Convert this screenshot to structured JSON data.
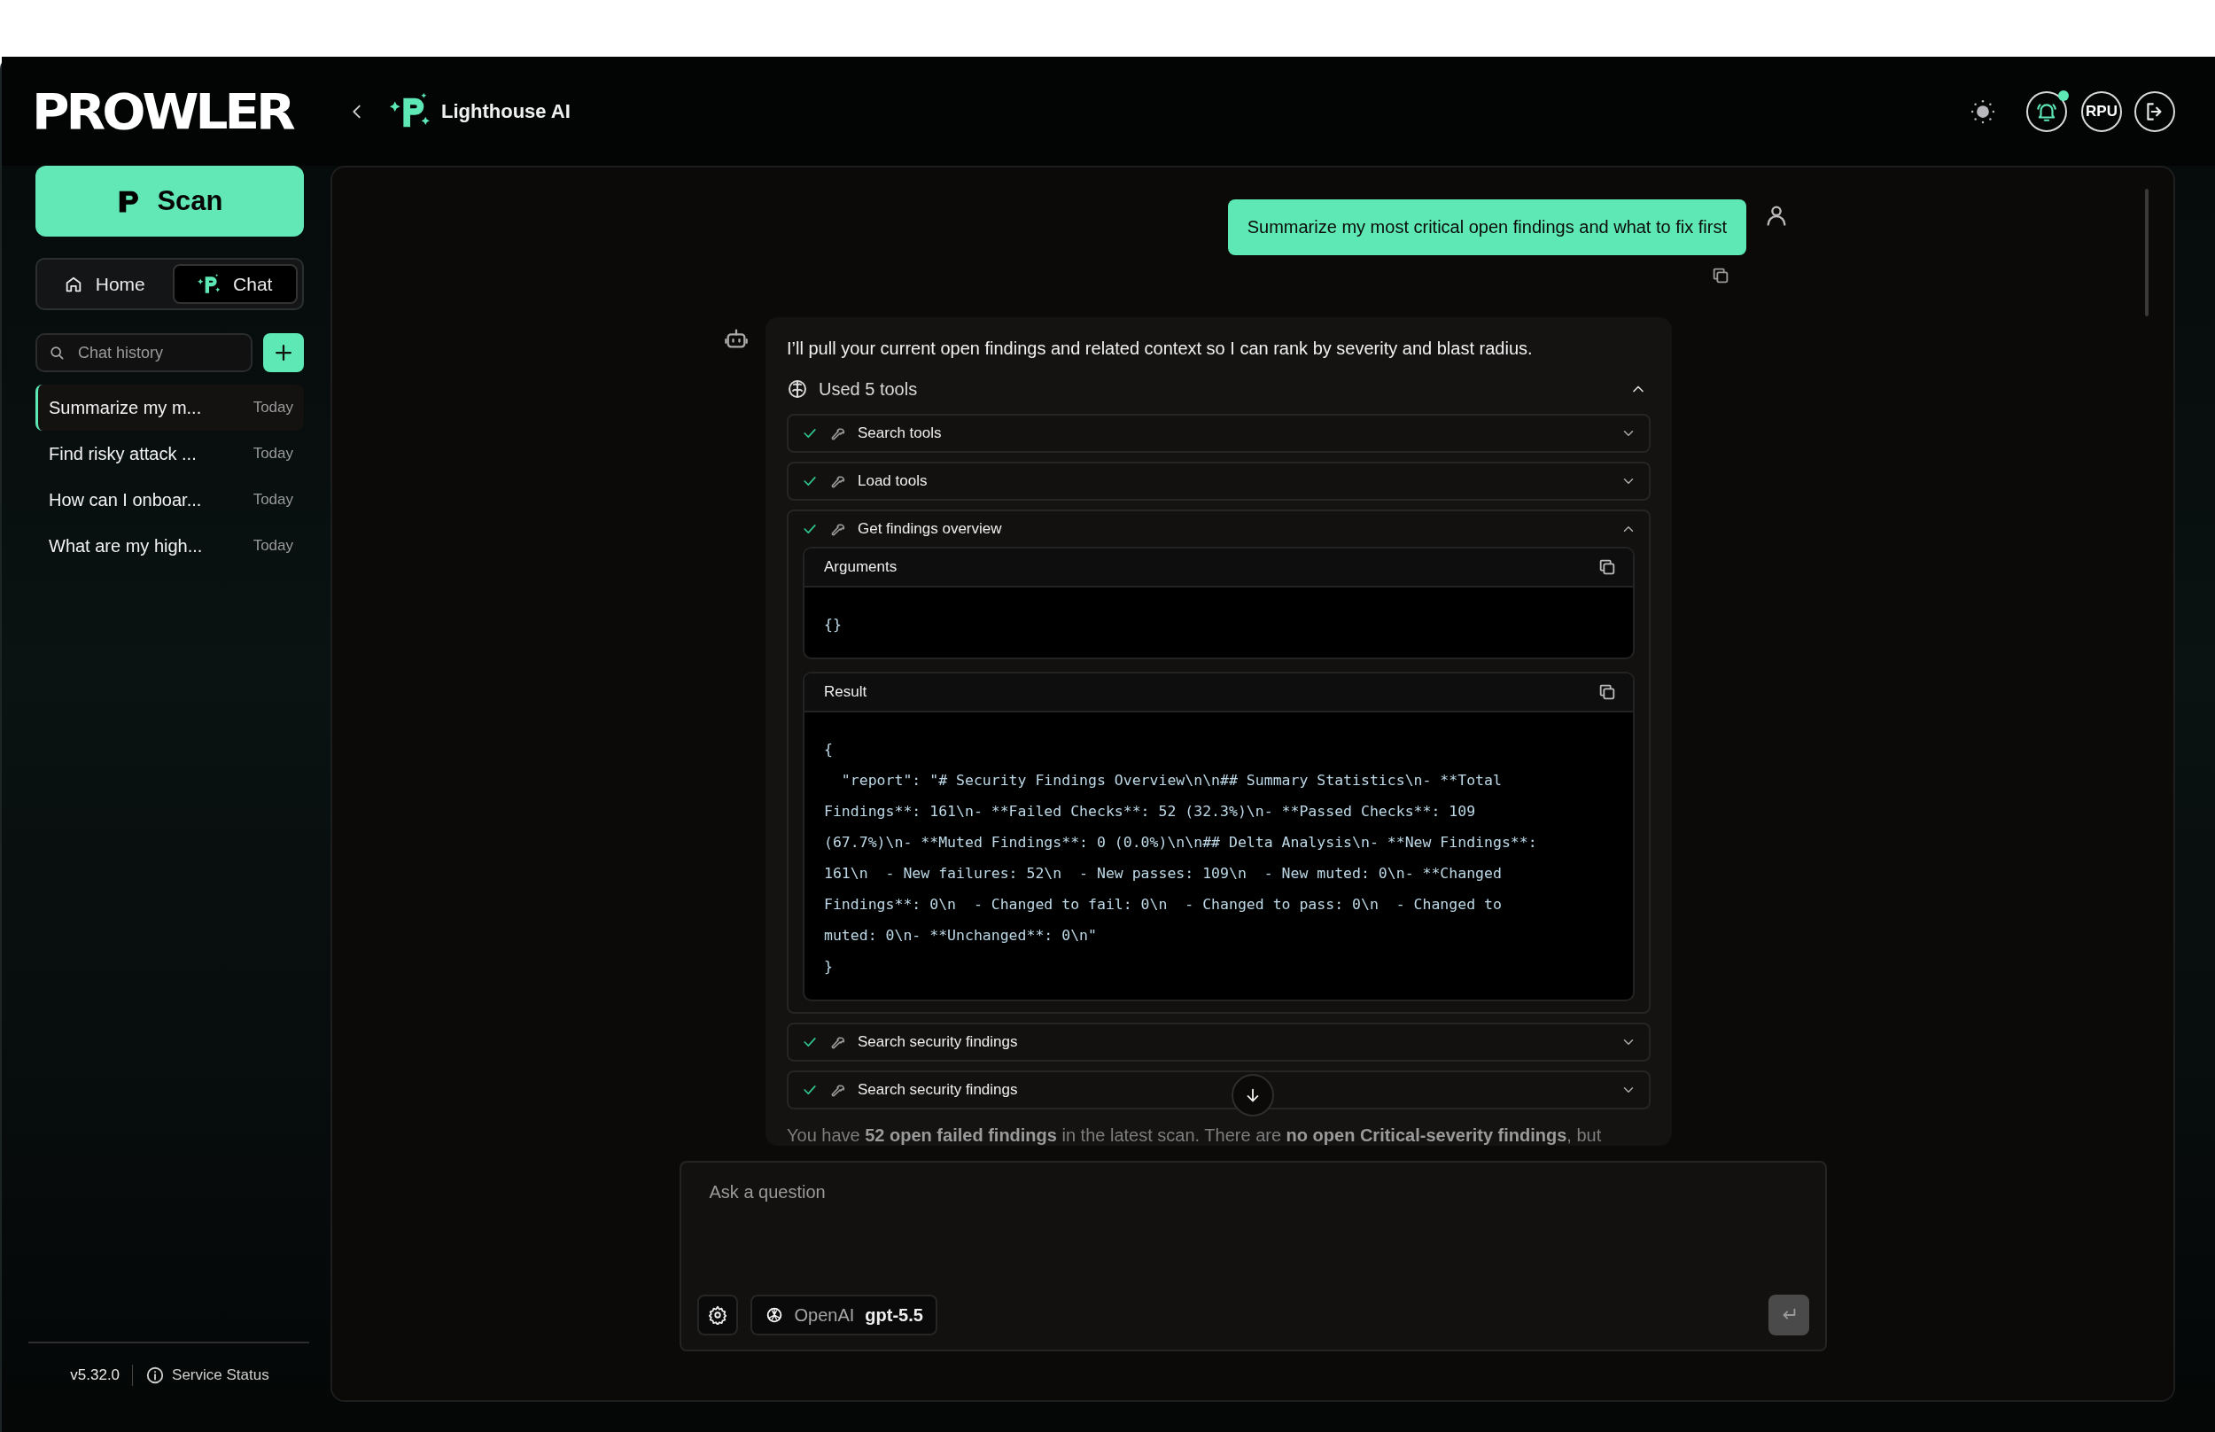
{
  "header": {
    "logo": "PROWLER",
    "page_title": "Lighthouse AI",
    "notification_unread": true,
    "avatar_initials": "RPU"
  },
  "sidebar": {
    "scan_button": "Scan",
    "nav": [
      {
        "label": "Home",
        "kind": "home",
        "selected": false
      },
      {
        "label": "Chat",
        "kind": "lighthouse",
        "selected": true
      }
    ],
    "search": {
      "placeholder": "Chat history"
    },
    "history": [
      {
        "title": "Summarize my m...",
        "date": "Today",
        "selected": true
      },
      {
        "title": "Find risky attack ...",
        "date": "Today",
        "selected": false
      },
      {
        "title": "How can I onboar...",
        "date": "Today",
        "selected": false
      },
      {
        "title": "What are my high...",
        "date": "Today",
        "selected": false
      }
    ],
    "footer": {
      "version": "v5.32.0",
      "status_link": "Service Status"
    }
  },
  "chat": {
    "messages": [
      {
        "kind": "user",
        "text": "Summarize my most critical open findings and what to fix first"
      },
      {
        "kind": "assistant",
        "text": "I’ll pull your current open findings and related context so I can rank by severity and blast radius.",
        "tools": {
          "label": "Used 5 tools",
          "expanded": true,
          "items": [
            {
              "name": "Search tools",
              "done": true,
              "expanded": false
            },
            {
              "name": "Load tools",
              "done": true,
              "expanded": false
            },
            {
              "name": "Get findings overview",
              "done": true,
              "expanded": true,
              "sections": [
                {
                  "title": "Arguments",
                  "code_lines": [
                    "{}"
                  ]
                },
                {
                  "title": "Result",
                  "code_lines": [
                    "{",
                    "  \"report\": \"# Security Findings Overview\\n\\n## Summary Statistics\\n- **Total",
                    "Findings**: 161\\n- **Failed Checks**: 52 (32.3%)\\n- **Passed Checks**: 109",
                    "(67.7%)\\n- **Muted Findings**: 0 (0.0%)\\n\\n## Delta Analysis\\n- **New Findings**:",
                    "161\\n  - New failures: 52\\n  - New passes: 109\\n  - New muted: 0\\n- **Changed",
                    "Findings**: 0\\n  - Changed to fail: 0\\n  - Changed to pass: 0\\n  - Changed to",
                    "muted: 0\\n- **Unchanged**: 0\\n\"",
                    "}"
                  ]
                }
              ]
            },
            {
              "name": "Search security findings",
              "done": true,
              "expanded": false
            },
            {
              "name": "Search security findings",
              "done": true,
              "expanded": false
            }
          ]
        },
        "reply": "You have **52 open failed findings** in the latest scan. There are **no open Critical-severity findings**, but"
      }
    ]
  },
  "composer": {
    "placeholder": "Ask a question",
    "provider": "OpenAI",
    "model": "gpt-5.5",
    "send_disabled": true
  }
}
